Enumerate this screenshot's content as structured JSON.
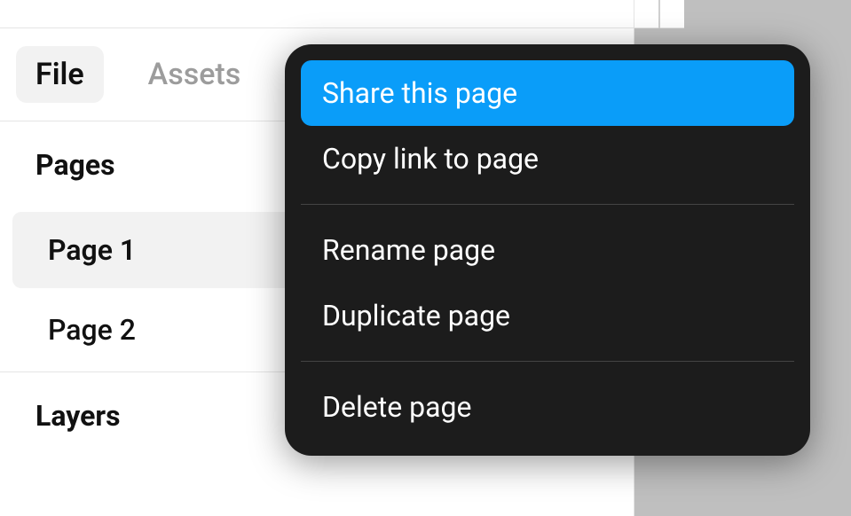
{
  "tabs": {
    "file": "File",
    "assets": "Assets"
  },
  "pages": {
    "header": "Pages",
    "items": [
      {
        "label": "Page 1"
      },
      {
        "label": "Page 2"
      }
    ]
  },
  "layers": {
    "header": "Layers"
  },
  "context_menu": {
    "items": [
      {
        "label": "Share this page"
      },
      {
        "label": "Copy link to page"
      },
      {
        "label": "Rename page"
      },
      {
        "label": "Duplicate page"
      },
      {
        "label": "Delete page"
      }
    ]
  }
}
